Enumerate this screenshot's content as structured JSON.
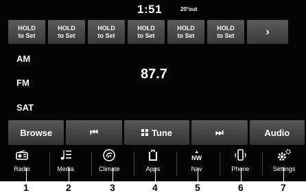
{
  "status": {
    "time": "1:51",
    "outside_temp": "20°out"
  },
  "presets": [
    {
      "line1": "HOLD",
      "line2": "to Set"
    },
    {
      "line1": "HOLD",
      "line2": "to Set"
    },
    {
      "line1": "HOLD",
      "line2": "to Set"
    },
    {
      "line1": "HOLD",
      "line2": "to Set"
    },
    {
      "line1": "HOLD",
      "line2": "to Set"
    },
    {
      "line1": "HOLD",
      "line2": "to Set"
    }
  ],
  "preset_next": "›",
  "bands": {
    "am": "AM",
    "fm": "FM",
    "sat": "SAT"
  },
  "frequency": "87.7",
  "controls": {
    "browse": "Browse",
    "prev": "⏮",
    "tune": "Tune",
    "next": "⏭",
    "audio": "Audio"
  },
  "nav": [
    {
      "label": "Radio",
      "icon": "radio-icon"
    },
    {
      "label": "Media",
      "icon": "media-icon"
    },
    {
      "label": "Climate",
      "icon": "climate-icon"
    },
    {
      "label": "Apps",
      "icon": "apps-icon"
    },
    {
      "label": "Nav",
      "icon": "compass-icon",
      "icon_text": "NW"
    },
    {
      "label": "Phone",
      "icon": "phone-icon"
    },
    {
      "label": "Settings",
      "icon": "gear-icon"
    }
  ],
  "callouts": [
    "1",
    "2",
    "3",
    "4",
    "5",
    "6",
    "7"
  ]
}
